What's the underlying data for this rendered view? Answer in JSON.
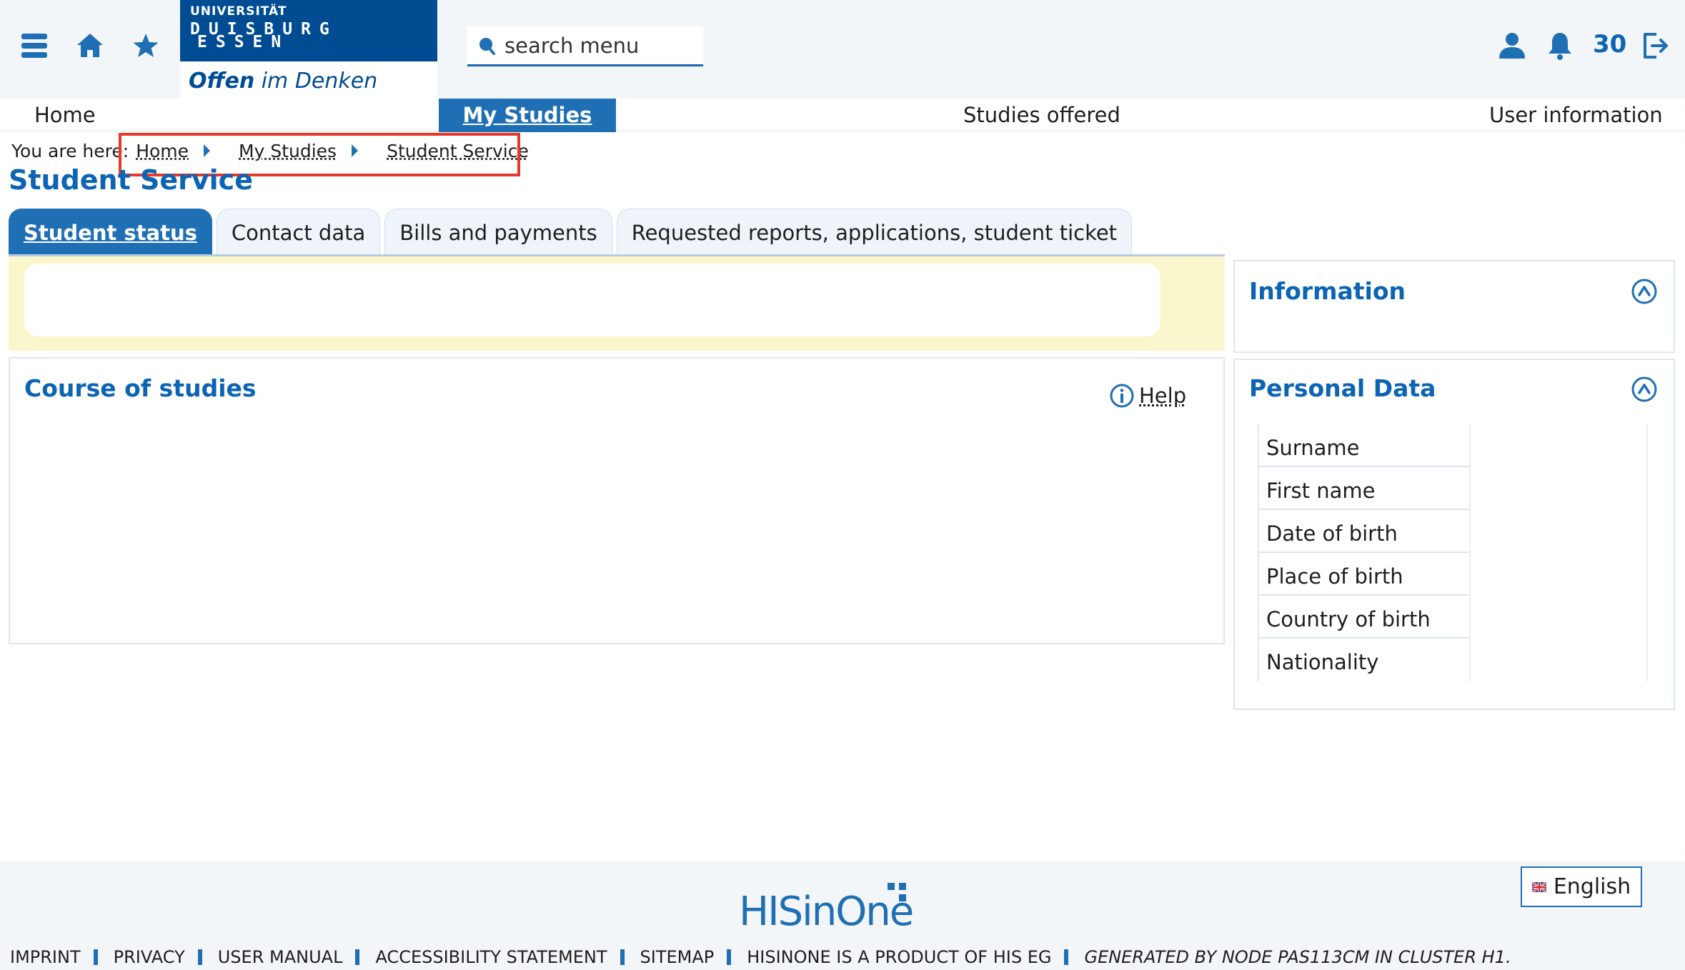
{
  "header": {
    "logo": {
      "university": "UNIVERSITÄT",
      "city1": "DUISBURG",
      "city2": "ESSEN",
      "slogan_bold": "Offen",
      "slogan_rest": " im Denken"
    },
    "search": {
      "placeholder": "search menu"
    },
    "notification_count": "30",
    "icons": [
      "menu-icon",
      "home-icon",
      "star-icon",
      "user-icon",
      "bell-icon",
      "logout-icon"
    ]
  },
  "mainnav": {
    "items": [
      {
        "label": "Home",
        "active": false
      },
      {
        "label": "My Studies",
        "active": true
      },
      {
        "label": "Studies offered",
        "active": false
      },
      {
        "label": "User information",
        "active": false
      }
    ]
  },
  "breadcrumb": {
    "prefix": "You are here:",
    "items": [
      "Home",
      "My Studies",
      "Student Service"
    ]
  },
  "page_title": "Student Service",
  "tabs": [
    {
      "label": "Student status",
      "active": true
    },
    {
      "label": "Contact data",
      "active": false
    },
    {
      "label": "Bills and payments",
      "active": false
    },
    {
      "label": "Requested reports, applications, student ticket",
      "active": false
    }
  ],
  "course_panel": {
    "title": "Course of studies",
    "help_label": "Help"
  },
  "information_panel": {
    "title": "Information"
  },
  "personal_data": {
    "title": "Personal Data",
    "fields": [
      "Surname",
      "First name",
      "Date of birth",
      "Place of birth",
      "Country of birth",
      "Nationality"
    ]
  },
  "footer": {
    "logo_text": "HISinOne",
    "language": "English",
    "links": [
      "IMPRINT",
      "PRIVACY",
      "USER MANUAL",
      "ACCESSIBILITY STATEMENT",
      "SITEMAP",
      "HISINONE IS A PRODUCT OF HIS EG"
    ],
    "generated": "GENERATED BY NODE PAS113CM IN CLUSTER H1."
  },
  "colors": {
    "primary": "#1f6fb5",
    "title_blue": "#0c64b4",
    "logo_blue": "#004c93",
    "notice_bg": "#fbf7cc",
    "highlight": "#e8382b"
  }
}
